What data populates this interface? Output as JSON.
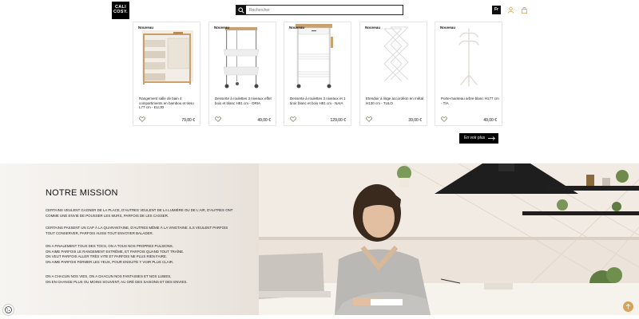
{
  "header": {
    "logo_text": "CALI COSY.",
    "search_placeholder": "Rechercher",
    "lang_label": "Fr"
  },
  "products": [
    {
      "badge": "Nouveau",
      "title": "Rangement salle de bain 4 compartiments en bambou et tissu L77 cm - ELIJO",
      "price": "79,00 €",
      "icon": "bathroom-storage-image"
    },
    {
      "badge": "Nouveau",
      "title": "Desserte à roulettes 3 niveaux effet bois et blanc H81 cm - ORIA",
      "price": "49,00 €",
      "icon": "trolley-image"
    },
    {
      "badge": "Nouveau",
      "title": "Desserte à roulettes 3 niveaux et 1 tiroir blanc et bois H81 cm - NAIA",
      "price": "129,00 €",
      "icon": "kitchen-cart-image"
    },
    {
      "badge": "Nouveau",
      "title": "Etendoir à linge accordéon en métal H130 cm - TULO",
      "price": "39,00 €",
      "icon": "drying-rack-image"
    },
    {
      "badge": "Nouveau",
      "title": "Porte-manteau arbre blanc H177 cm - TIA",
      "price": "49,00 €",
      "icon": "coat-rack-image"
    }
  ],
  "see_more_label": "En voir plus",
  "mission": {
    "title": "NOTRE MISSION",
    "paragraphs": [
      [
        "Certains veulent gagner de la place, d'autres veulent de la lumière ou de l'air, d'autres ont",
        "comme une envie de pousser les murs, parfois de les casser."
      ],
      [
        "Certains passent un cap à la quarantaine, d'autres même à la vingtaine. Ils veulent parfois",
        "tout conserver, parfois aussi tout envoyer balader."
      ],
      [
        "On a finalement tous des tocs, on a tous nos propres pulsions.",
        "On aime parfois le rangement extrême, et parfois quand tout traîne.",
        "On veut parfois aller très vite et parfois ne plus rien faire.",
        "On aime parfois fermer les yeux, pour ensuite y voir plus clair."
      ],
      [
        "On a chacun nos vies, on a chacun nos fantaisies et nos lubies,",
        "on en change plus ou moins souvent, au gré des saisons et des envies."
      ]
    ]
  },
  "colors": {
    "accent": "#000000",
    "scroll_top": "#d6a35a"
  }
}
